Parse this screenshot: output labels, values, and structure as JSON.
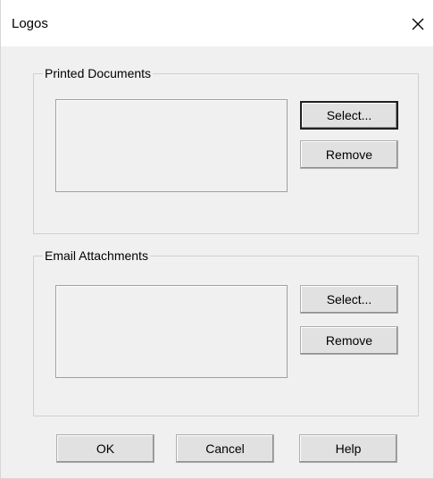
{
  "window": {
    "title": "Logos"
  },
  "printed_documents": {
    "label": "Printed Documents",
    "select_label": "Select...",
    "remove_label": "Remove"
  },
  "email_attachments": {
    "label": "Email Attachments",
    "select_label": "Select...",
    "remove_label": "Remove"
  },
  "footer": {
    "ok_label": "OK",
    "cancel_label": "Cancel",
    "help_label": "Help"
  },
  "icons": {
    "close": "close-icon"
  }
}
